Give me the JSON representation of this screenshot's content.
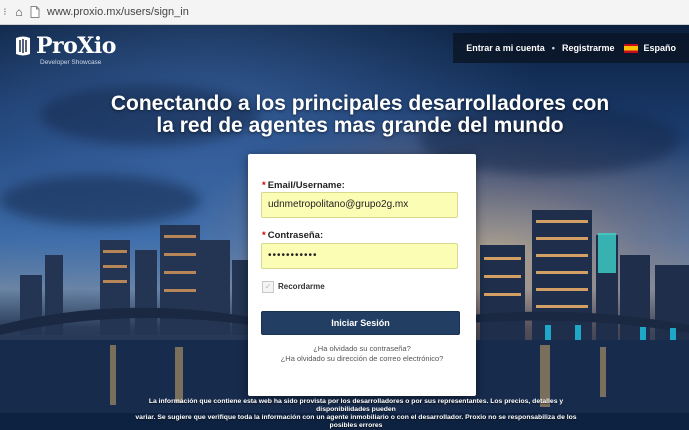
{
  "browser": {
    "url": "www.proxio.mx/users/sign_in"
  },
  "brand": {
    "name": "ProXio",
    "tagline": "Developer Showcase"
  },
  "nav": {
    "login": "Entrar a mi cuenta",
    "separator": "•",
    "register": "Registrarme",
    "language": "Españo"
  },
  "hero": {
    "headline_line1": "Conectando a los principales desarrolladores con",
    "headline_line2": "la red de agentes mas grande del mundo"
  },
  "login_form": {
    "email_label": "Email/Username:",
    "email_value": "udnmetropolitano@grupo2g.mx",
    "password_label": "Contraseña:",
    "password_value": "•••••••••••",
    "required_mark": "*",
    "remember_label": "Recordarme",
    "submit_label": "Iniciar Sesión",
    "forgot_password": "¿Ha olvidado su contraseña?",
    "forgot_email": "¿Ha olvidado su dirección de correo electrónico?"
  },
  "disclaimer": {
    "line1": "La información que contiene esta web ha sido provista por los desarrolladores o por sus representantes. Los precios, detalles y disponibilidades pueden",
    "line2": "variar. Se sugiere que verifique toda la información con un agente inmobiliario o con el desarrollador. Proxio no se responsabiliza de los posibles errores"
  },
  "colors": {
    "accent": "#223f63",
    "input_bg": "#fbfdb4",
    "required": "#cc0000"
  }
}
